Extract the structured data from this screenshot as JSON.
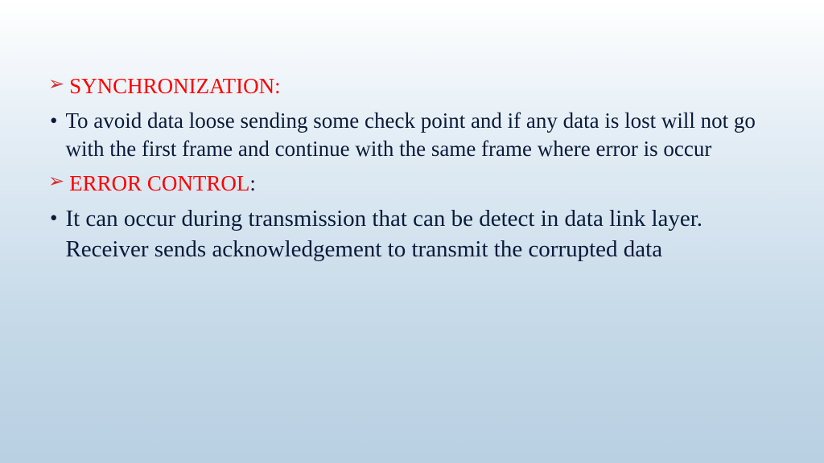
{
  "slide": {
    "heading1": "SYNCHRONIZATION:",
    "body1": "To avoid data loose sending some check point and if any data is lost will not go with the first frame and continue with the same frame where error is occur",
    "heading2": "ERROR CONTROL",
    "colon2": ":",
    "body2": "It can occur during transmission that can be detect in data link layer. Receiver sends acknowledgement to transmit the corrupted data"
  }
}
